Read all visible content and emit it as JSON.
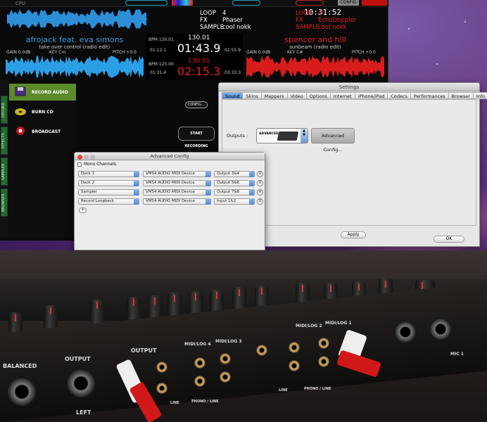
{
  "desktop": {},
  "dj": {
    "top": {
      "cpu": "CPU",
      "config": "CONFIG",
      "clock": "10:31:52"
    },
    "left_deck": {
      "info_keys": [
        "LOOP",
        "FX",
        "SAMPLE"
      ],
      "info_vals": [
        "4",
        "Phaser",
        "cool nokk"
      ],
      "title": "afrojack feat. eva simons",
      "subtitle": "take over control (radio edit)",
      "gain": "GAIN 0.0dB",
      "key": "KEY Cm",
      "pitch": "PITCH +0.0",
      "color": "#3aa0e0"
    },
    "right_deck": {
      "info_keys": [
        "LOOP",
        "FX",
        "SAMPLE"
      ],
      "info_vals": [
        "4",
        "EchoDoppler",
        "cool nokk"
      ],
      "title": "spencer and hill",
      "subtitle": "sunbeam (radio edit)",
      "gain": "GAIN 0.0dB",
      "key": "KEY C#",
      "pitch": "PITCH +0.0",
      "color": "#e02020"
    },
    "center": {
      "bpm_top_label": "BPM 130.01",
      "bpm_top": "130.01",
      "time_top_left": "01:12.1",
      "time_top": "01:43.9",
      "time_top_right": "02:55.9",
      "bpm_bottom_label": "BPM 125.00",
      "bpm_bottom": "130.01",
      "time_bottom_left": "01:31.4",
      "time_bottom": "02:15.3",
      "time_bottom_right": "03:33.3"
    },
    "side_tabs": [
      "RECORD",
      "EFFECTS",
      "SAMPLER",
      "BROWSER"
    ],
    "record_items": [
      {
        "label": "RECORD AUDIO",
        "icon": "disk-icon"
      },
      {
        "label": "BURN CD",
        "icon": "cd-icon"
      },
      {
        "label": "BROADCAST",
        "icon": "broadcast-icon"
      }
    ],
    "config_button": "CONFIG...",
    "start_button": "START RECORDING"
  },
  "settings": {
    "title": "Settings",
    "tabs": [
      "Sound Setup",
      "Skins",
      "Mappers",
      "Video",
      "Options",
      "Internet",
      "iPhone/iPad",
      "Codecs",
      "Performances",
      "Browser",
      "Info"
    ],
    "active_tab": "Sound Setup",
    "outputs_label": "Outputs :",
    "device_label": "ADVANCED CONFIG",
    "advanced_button": "Advanced Config...",
    "apply_button": "Apply",
    "ok_button": "OK"
  },
  "advanced": {
    "title": "Advanced Config",
    "mono_label": "Mono Channels",
    "rows": [
      {
        "source": "Deck 1",
        "device": "VMS4 AUDIO MIDI Device",
        "port": "Output 3&4"
      },
      {
        "source": "Deck 2",
        "device": "VMS4 AUDIO MIDI Device",
        "port": "Output 5&6"
      },
      {
        "source": "Sampler",
        "device": "VMS4 AUDIO MIDI Device",
        "port": "Output 7&8"
      },
      {
        "source": "Record Loopback",
        "device": "VMS4 AUDIO MIDI Device",
        "port": "Input 1&2"
      }
    ],
    "remove_label": "X",
    "add_label": "+"
  },
  "photo": {
    "labels": [
      "BALANCED",
      "OUTPUT",
      "OUTPUT",
      "MIDI/LOG 4",
      "MIDI/LOG 3",
      "MIDI/LOG 2",
      "MIDI/LOG 1",
      "MIC 1",
      "LINE",
      "PHONO / LINE",
      "LINE",
      "PHONO / LINE",
      "LEFT"
    ]
  }
}
